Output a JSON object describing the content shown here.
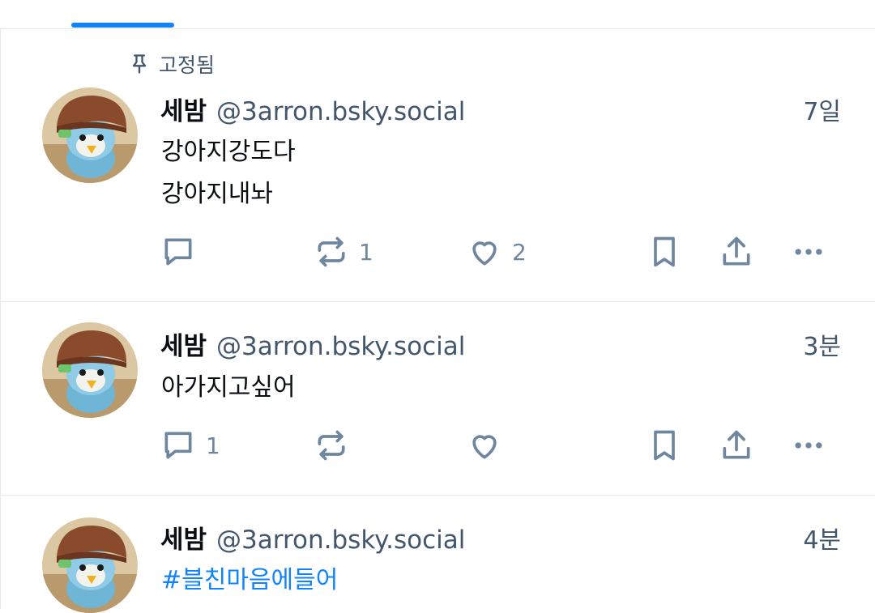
{
  "feed": {
    "pinned_label": "고정됨",
    "posts": [
      {
        "author_name": "세밤",
        "handle": "@3arron.bsky.social",
        "time": "7일",
        "lines": [
          "강아지강도다",
          "강아지내놔"
        ],
        "reply_count": "",
        "repost_count": "1",
        "like_count": "2"
      },
      {
        "author_name": "세밤",
        "handle": "@3arron.bsky.social",
        "time": "3분",
        "lines": [
          "아가지고싶어"
        ],
        "reply_count": "1",
        "repost_count": "",
        "like_count": ""
      },
      {
        "author_name": "세밤",
        "handle": "@3arron.bsky.social",
        "time": "4분",
        "lines": [
          "#블친마음에들어"
        ],
        "reply_count": "",
        "repost_count": "",
        "like_count": ""
      }
    ]
  },
  "colors": {
    "accent": "#1083fe",
    "muted_text": "#42576c",
    "icon": "#6f869f",
    "divider": "#e6eaef"
  },
  "icons": [
    "pin-icon",
    "reply-icon",
    "repost-icon",
    "like-icon",
    "bookmark-icon",
    "share-icon",
    "more-icon"
  ]
}
